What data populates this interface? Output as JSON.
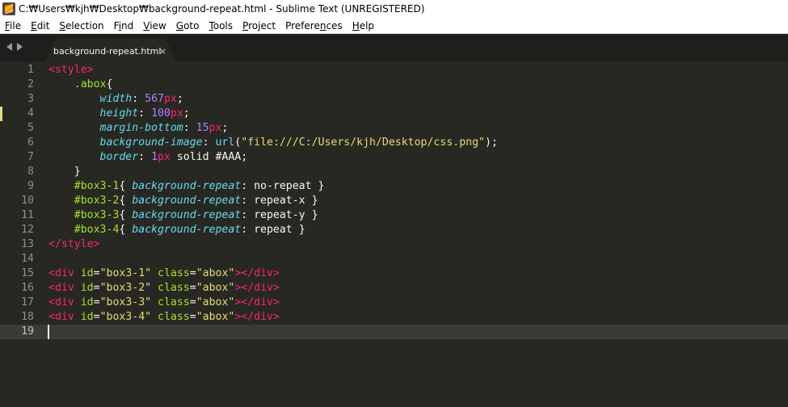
{
  "window": {
    "title": "C:₩Users₩kjh₩Desktop₩background-repeat.html - Sublime Text (UNREGISTERED)"
  },
  "menu": [
    {
      "label": "File",
      "u": "F",
      "rest": "ile"
    },
    {
      "label": "Edit",
      "u": "E",
      "rest": "dit"
    },
    {
      "label": "Selection",
      "u": "S",
      "rest": "election"
    },
    {
      "label": "Find",
      "pre": "F",
      "u": "i",
      "rest": "nd"
    },
    {
      "label": "View",
      "u": "V",
      "rest": "iew"
    },
    {
      "label": "Goto",
      "u": "G",
      "rest": "oto"
    },
    {
      "label": "Tools",
      "u": "T",
      "rest": "ools"
    },
    {
      "label": "Project",
      "u": "P",
      "rest": "roject"
    },
    {
      "label": "Preferences",
      "pre": "Prefere",
      "u": "n",
      "rest": "ces"
    },
    {
      "label": "Help",
      "u": "H",
      "rest": "elp"
    }
  ],
  "tab": {
    "label": "background-repeat.html",
    "close": "×"
  },
  "editor": {
    "current_line": 19,
    "modified_lines": [
      4
    ],
    "lines": [
      {
        "n": "1",
        "tokens": [
          [
            "t-tag",
            "<style>"
          ]
        ]
      },
      {
        "n": "2",
        "tokens": [
          [
            "t-plain",
            "    "
          ],
          [
            "t-sel",
            ".abox"
          ],
          [
            "t-plain",
            "{"
          ]
        ]
      },
      {
        "n": "3",
        "tokens": [
          [
            "t-plain",
            "        "
          ],
          [
            "t-prop",
            "width"
          ],
          [
            "t-plain",
            ": "
          ],
          [
            "t-num",
            "567"
          ],
          [
            "t-unit",
            "px"
          ],
          [
            "t-plain",
            ";"
          ]
        ]
      },
      {
        "n": "4",
        "tokens": [
          [
            "t-plain",
            "        "
          ],
          [
            "t-prop",
            "height"
          ],
          [
            "t-plain",
            ": "
          ],
          [
            "t-num",
            "100"
          ],
          [
            "t-unit",
            "px"
          ],
          [
            "t-plain",
            ";"
          ]
        ]
      },
      {
        "n": "5",
        "tokens": [
          [
            "t-plain",
            "        "
          ],
          [
            "t-prop",
            "margin-bottom"
          ],
          [
            "t-plain",
            ": "
          ],
          [
            "t-num",
            "15"
          ],
          [
            "t-unit",
            "px"
          ],
          [
            "t-plain",
            ";"
          ]
        ]
      },
      {
        "n": "6",
        "tokens": [
          [
            "t-plain",
            "        "
          ],
          [
            "t-prop",
            "background-image"
          ],
          [
            "t-plain",
            ": "
          ],
          [
            "t-fn",
            "url"
          ],
          [
            "t-plain",
            "("
          ],
          [
            "t-str",
            "\"file:///C:/Users/kjh/Desktop/css.png\""
          ],
          [
            "t-plain",
            ");"
          ]
        ]
      },
      {
        "n": "7",
        "tokens": [
          [
            "t-plain",
            "        "
          ],
          [
            "t-prop",
            "border"
          ],
          [
            "t-plain",
            ": "
          ],
          [
            "t-num",
            "1"
          ],
          [
            "t-unit",
            "px"
          ],
          [
            "t-val",
            " solid "
          ],
          [
            "t-val",
            "#AAA"
          ],
          [
            "t-plain",
            ";"
          ]
        ]
      },
      {
        "n": "8",
        "tokens": [
          [
            "t-plain",
            "    }"
          ]
        ]
      },
      {
        "n": "9",
        "tokens": [
          [
            "t-plain",
            "    "
          ],
          [
            "t-sel",
            "#box3-1"
          ],
          [
            "t-plain",
            "{ "
          ],
          [
            "t-prop",
            "background-repeat"
          ],
          [
            "t-plain",
            ": "
          ],
          [
            "t-val",
            "no-repeat"
          ],
          [
            "t-plain",
            " }"
          ]
        ]
      },
      {
        "n": "10",
        "tokens": [
          [
            "t-plain",
            "    "
          ],
          [
            "t-sel",
            "#box3-2"
          ],
          [
            "t-plain",
            "{ "
          ],
          [
            "t-prop",
            "background-repeat"
          ],
          [
            "t-plain",
            ": "
          ],
          [
            "t-val",
            "repeat-x"
          ],
          [
            "t-plain",
            " }"
          ]
        ]
      },
      {
        "n": "11",
        "tokens": [
          [
            "t-plain",
            "    "
          ],
          [
            "t-sel",
            "#box3-3"
          ],
          [
            "t-plain",
            "{ "
          ],
          [
            "t-prop",
            "background-repeat"
          ],
          [
            "t-plain",
            ": "
          ],
          [
            "t-val",
            "repeat-y"
          ],
          [
            "t-plain",
            " }"
          ]
        ]
      },
      {
        "n": "12",
        "tokens": [
          [
            "t-plain",
            "    "
          ],
          [
            "t-sel",
            "#box3-4"
          ],
          [
            "t-plain",
            "{ "
          ],
          [
            "t-prop",
            "background-repeat"
          ],
          [
            "t-plain",
            ": "
          ],
          [
            "t-val",
            "repeat"
          ],
          [
            "t-plain",
            " }"
          ]
        ]
      },
      {
        "n": "13",
        "tokens": [
          [
            "t-tag",
            "</style>"
          ]
        ]
      },
      {
        "n": "14",
        "tokens": []
      },
      {
        "n": "15",
        "tokens": [
          [
            "t-tag",
            "<div"
          ],
          [
            "t-plain",
            " "
          ],
          [
            "t-attr",
            "id"
          ],
          [
            "t-plain",
            "="
          ],
          [
            "t-str",
            "\"box3-1\""
          ],
          [
            "t-plain",
            " "
          ],
          [
            "t-attr",
            "class"
          ],
          [
            "t-plain",
            "="
          ],
          [
            "t-str",
            "\"abox\""
          ],
          [
            "t-tag",
            "></div>"
          ]
        ]
      },
      {
        "n": "16",
        "tokens": [
          [
            "t-tag",
            "<div"
          ],
          [
            "t-plain",
            " "
          ],
          [
            "t-attr",
            "id"
          ],
          [
            "t-plain",
            "="
          ],
          [
            "t-str",
            "\"box3-2\""
          ],
          [
            "t-plain",
            " "
          ],
          [
            "t-attr",
            "class"
          ],
          [
            "t-plain",
            "="
          ],
          [
            "t-str",
            "\"abox\""
          ],
          [
            "t-tag",
            "></div>"
          ]
        ]
      },
      {
        "n": "17",
        "tokens": [
          [
            "t-tag",
            "<div"
          ],
          [
            "t-plain",
            " "
          ],
          [
            "t-attr",
            "id"
          ],
          [
            "t-plain",
            "="
          ],
          [
            "t-str",
            "\"box3-3\""
          ],
          [
            "t-plain",
            " "
          ],
          [
            "t-attr",
            "class"
          ],
          [
            "t-plain",
            "="
          ],
          [
            "t-str",
            "\"abox\""
          ],
          [
            "t-tag",
            "></div>"
          ]
        ]
      },
      {
        "n": "18",
        "tokens": [
          [
            "t-tag",
            "<div"
          ],
          [
            "t-plain",
            " "
          ],
          [
            "t-attr",
            "id"
          ],
          [
            "t-plain",
            "="
          ],
          [
            "t-str",
            "\"box3-4\""
          ],
          [
            "t-plain",
            " "
          ],
          [
            "t-attr",
            "class"
          ],
          [
            "t-plain",
            "="
          ],
          [
            "t-str",
            "\"abox\""
          ],
          [
            "t-tag",
            "></div>"
          ]
        ]
      },
      {
        "n": "19",
        "tokens": []
      }
    ]
  },
  "colors": {
    "background": "#272822",
    "tag": "#f92672",
    "selector": "#a6e22e",
    "property": "#66d9ef",
    "number": "#ae81ff",
    "string": "#e6db74"
  }
}
